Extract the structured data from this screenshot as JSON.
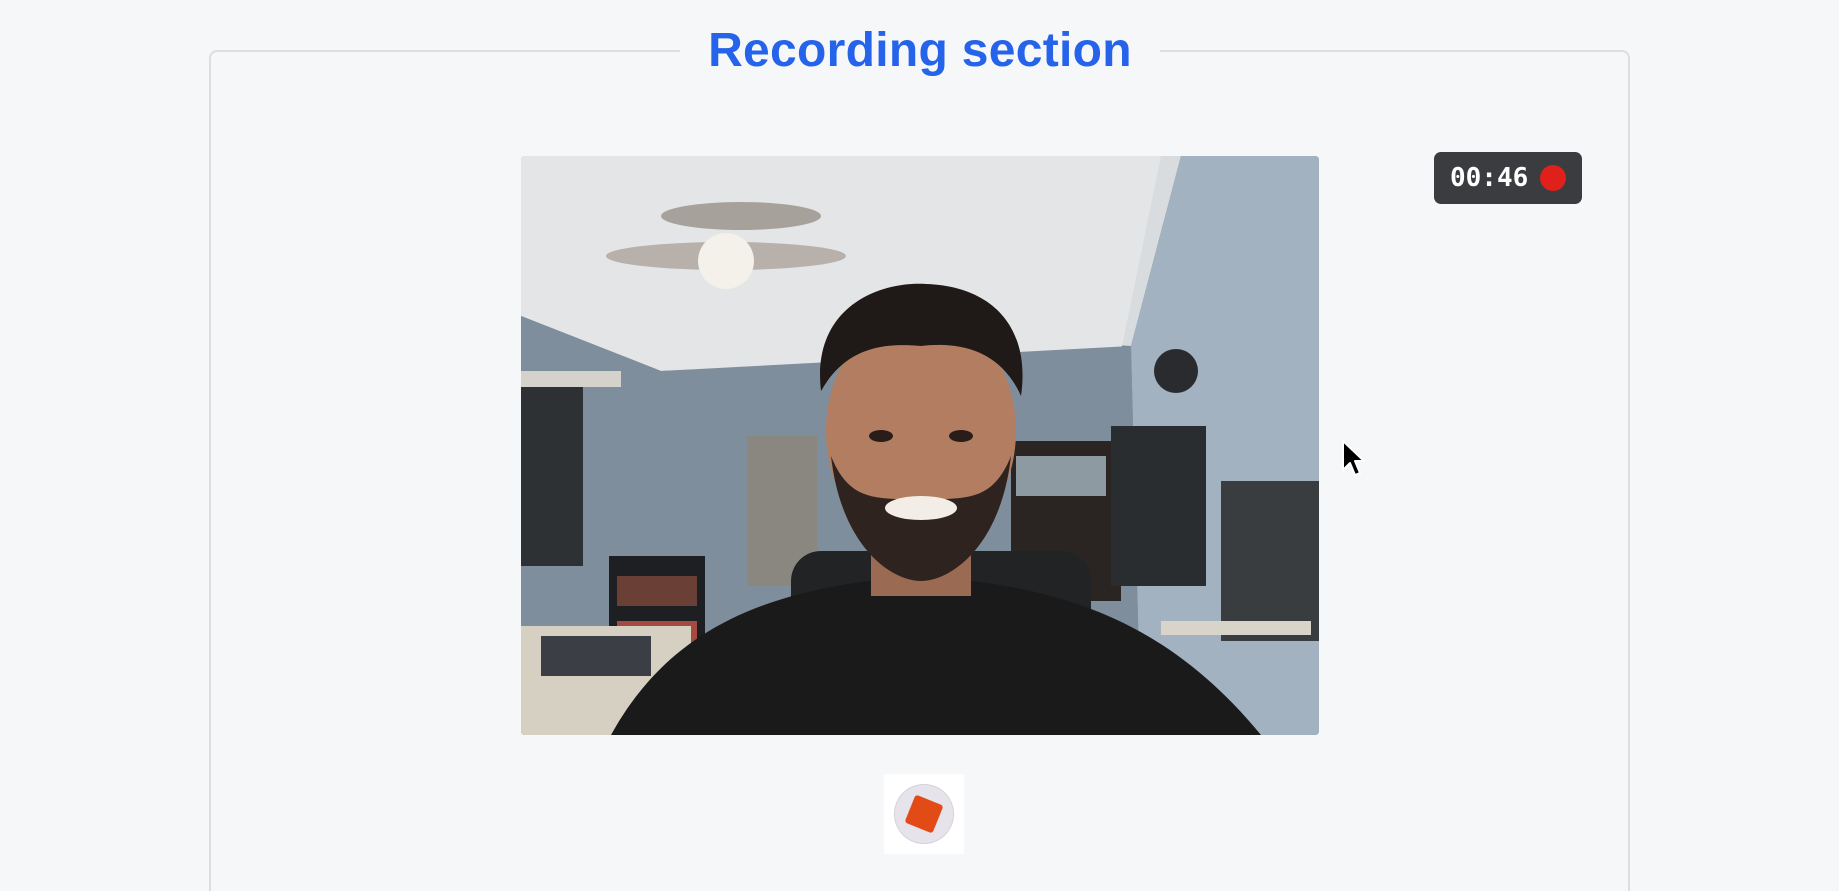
{
  "section": {
    "title": "Recording section"
  },
  "video": {
    "subject": "webcam-feed"
  },
  "timer": {
    "elapsed": "00:46",
    "indicator_color": "#e0201a"
  },
  "controls": {
    "stop_icon": "stop-icon",
    "stop_color": "#e24a16"
  },
  "colors": {
    "accent": "#2563eb",
    "background": "#f6f7f9",
    "timer_bg": "#3a3c3f"
  }
}
